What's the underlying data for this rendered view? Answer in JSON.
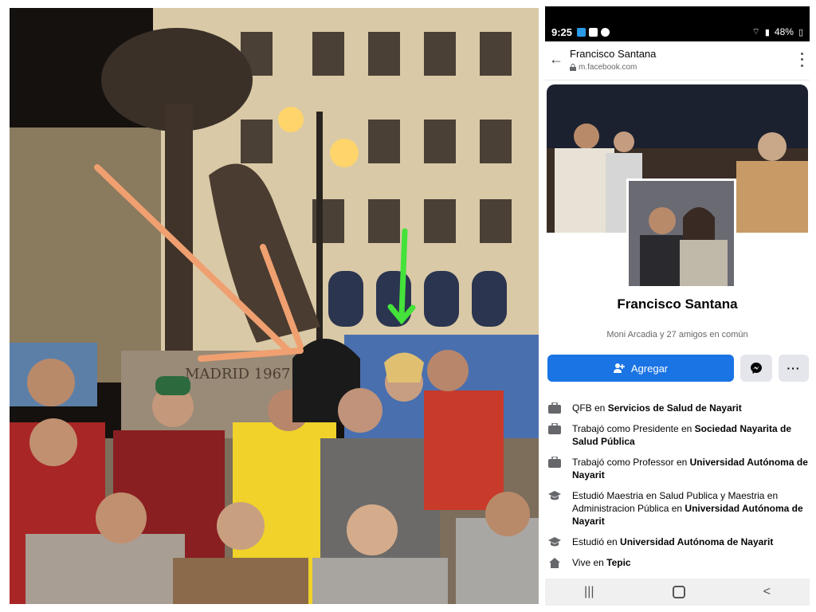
{
  "photo": {
    "statue_plaque": "MADRID 1967",
    "arrow_colors": {
      "orange": "#f0a070",
      "green": "#44e23a"
    }
  },
  "phone": {
    "status_bar": {
      "time": "9:25",
      "battery": "48%"
    },
    "header": {
      "title": "Francisco Santana",
      "url": "m.facebook.com"
    },
    "profile": {
      "name": "Francisco Santana",
      "mutual_friends": "Moni Arcadia y 27 amigos en común"
    },
    "actions": {
      "add_label": "Agregar",
      "more_label": "···"
    },
    "info": [
      {
        "icon": "briefcase-icon",
        "prefix": "QFB en ",
        "bold": "Servicios de Salud de Nayarit"
      },
      {
        "icon": "briefcase-icon",
        "prefix": "Trabajó como Presidente en ",
        "bold": "Sociedad Nayarita de Salud Pública"
      },
      {
        "icon": "briefcase-icon",
        "prefix": "Trabajó como Professor en ",
        "bold": "Universidad Autónoma de Nayarit"
      },
      {
        "icon": "graduation-cap-icon",
        "prefix": "Estudió Maestria en Salud Publica y Maestria en Administracion Pública en ",
        "bold": "Universidad Autónoma de Nayarit"
      },
      {
        "icon": "graduation-cap-icon",
        "prefix": "Estudió en ",
        "bold": "Universidad Autónoma de Nayarit"
      },
      {
        "icon": "home-icon",
        "prefix": "Vive en ",
        "bold": "Tepic"
      }
    ],
    "navbar": {
      "recent": "|||",
      "back": "<"
    },
    "colors": {
      "facebook_blue": "#1b74e4",
      "button_gray": "#e4e6eb"
    }
  }
}
